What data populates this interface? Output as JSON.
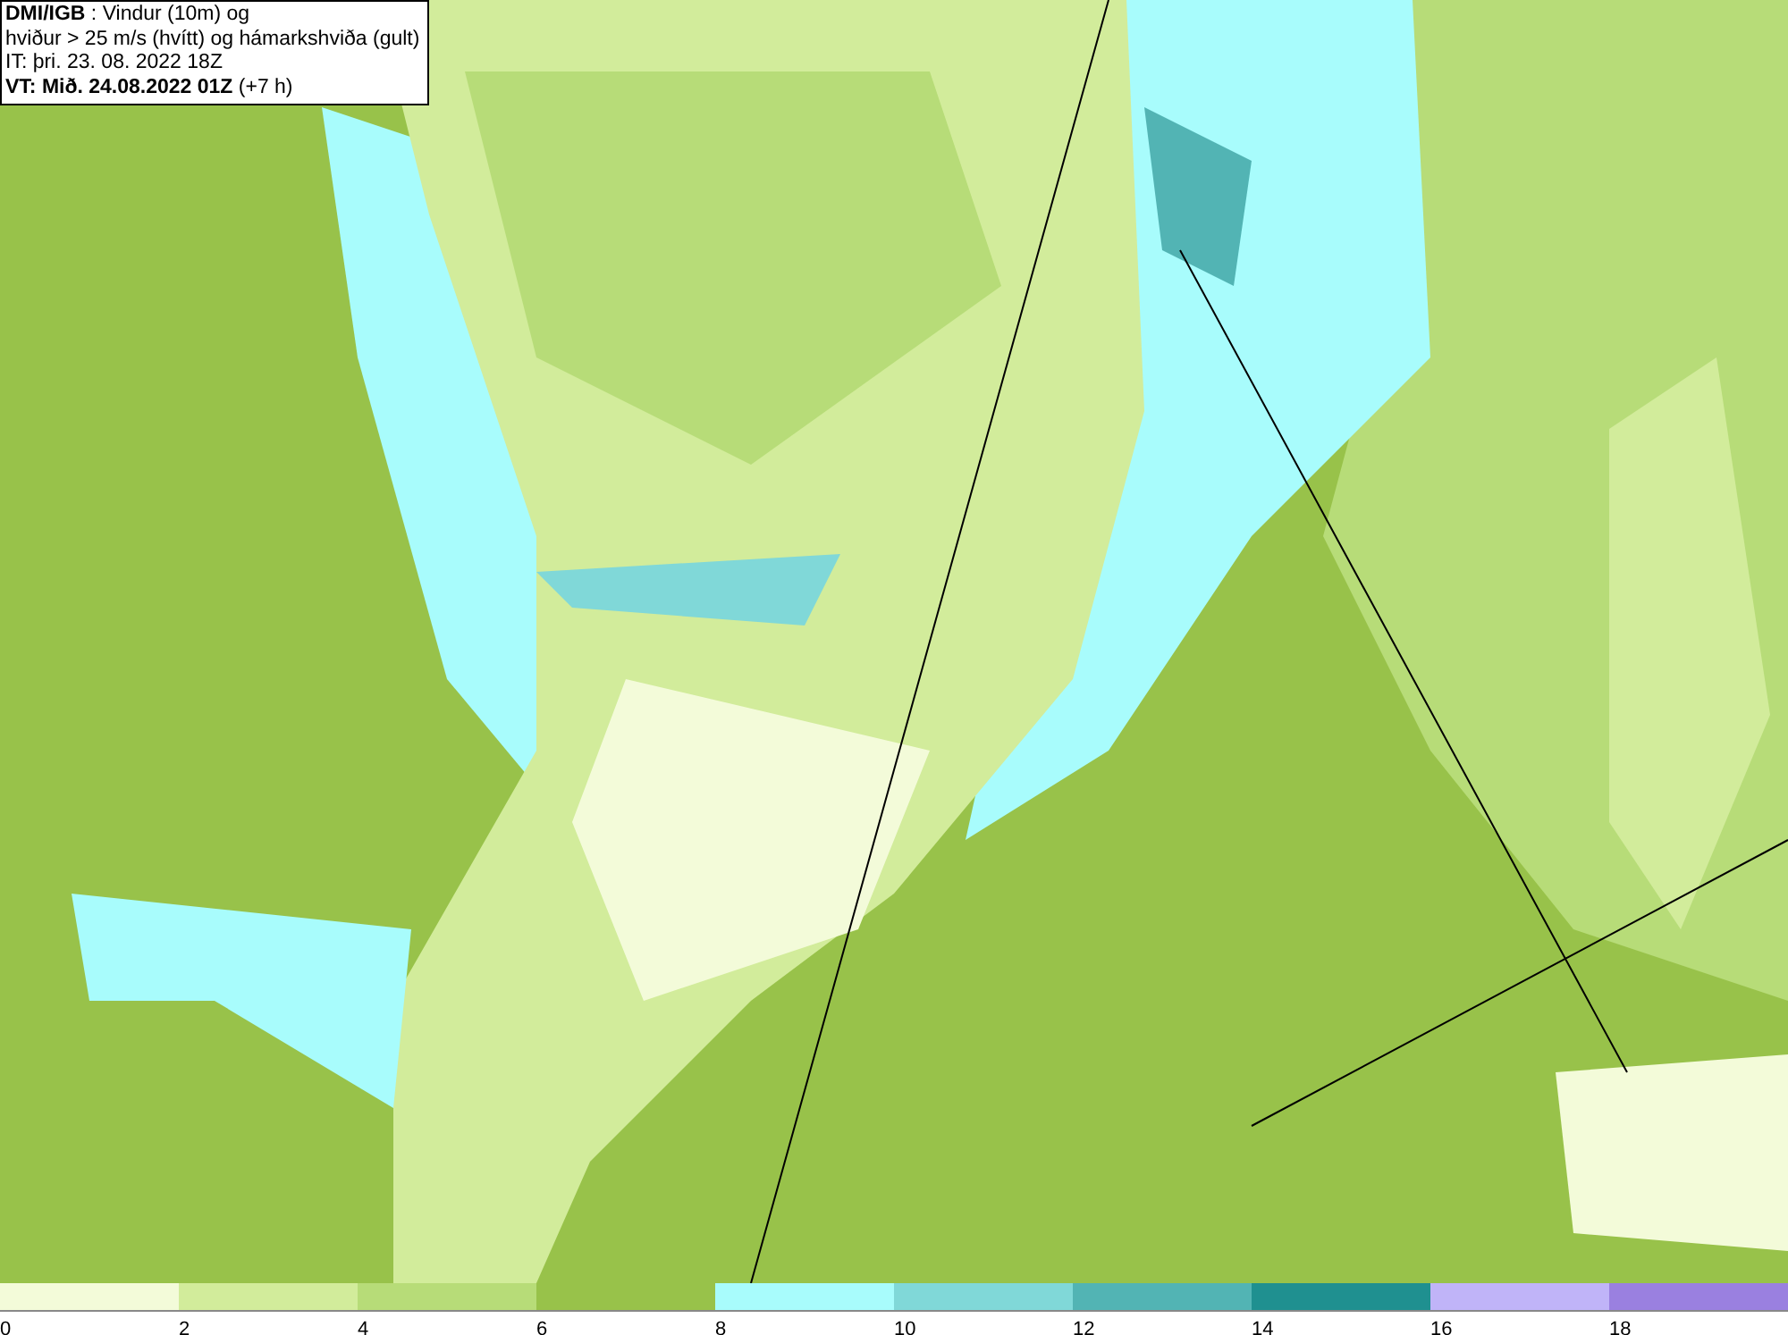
{
  "info_box": {
    "lines": [
      "**DMI/IGB** : Vindur (10m) og",
      "hviður > 25 m/s (hvítt) og hámarkshviða (gult)",
      "IT: þri. 23. 08. 2022 18Z",
      "**VT: Mið. 24.08.2022 01Z** (+7 h)"
    ]
  },
  "legend": [
    {
      "label": "0",
      "color": "#f3fbd9"
    },
    {
      "label": "2",
      "color": "#d2ec9b"
    },
    {
      "label": "4",
      "color": "#b7dc78"
    },
    {
      "label": "6",
      "color": "#98c24a"
    },
    {
      "label": "8",
      "color": "#a8fcfc"
    },
    {
      "label": "10",
      "color": "#80d8d8"
    },
    {
      "label": "12",
      "color": "#52b4b4"
    },
    {
      "label": "14",
      "color": "#1f9090"
    },
    {
      "label": "16",
      "color": "#c0b4f8"
    },
    {
      "label": "18",
      "color": "#9a80e0"
    }
  ]
}
